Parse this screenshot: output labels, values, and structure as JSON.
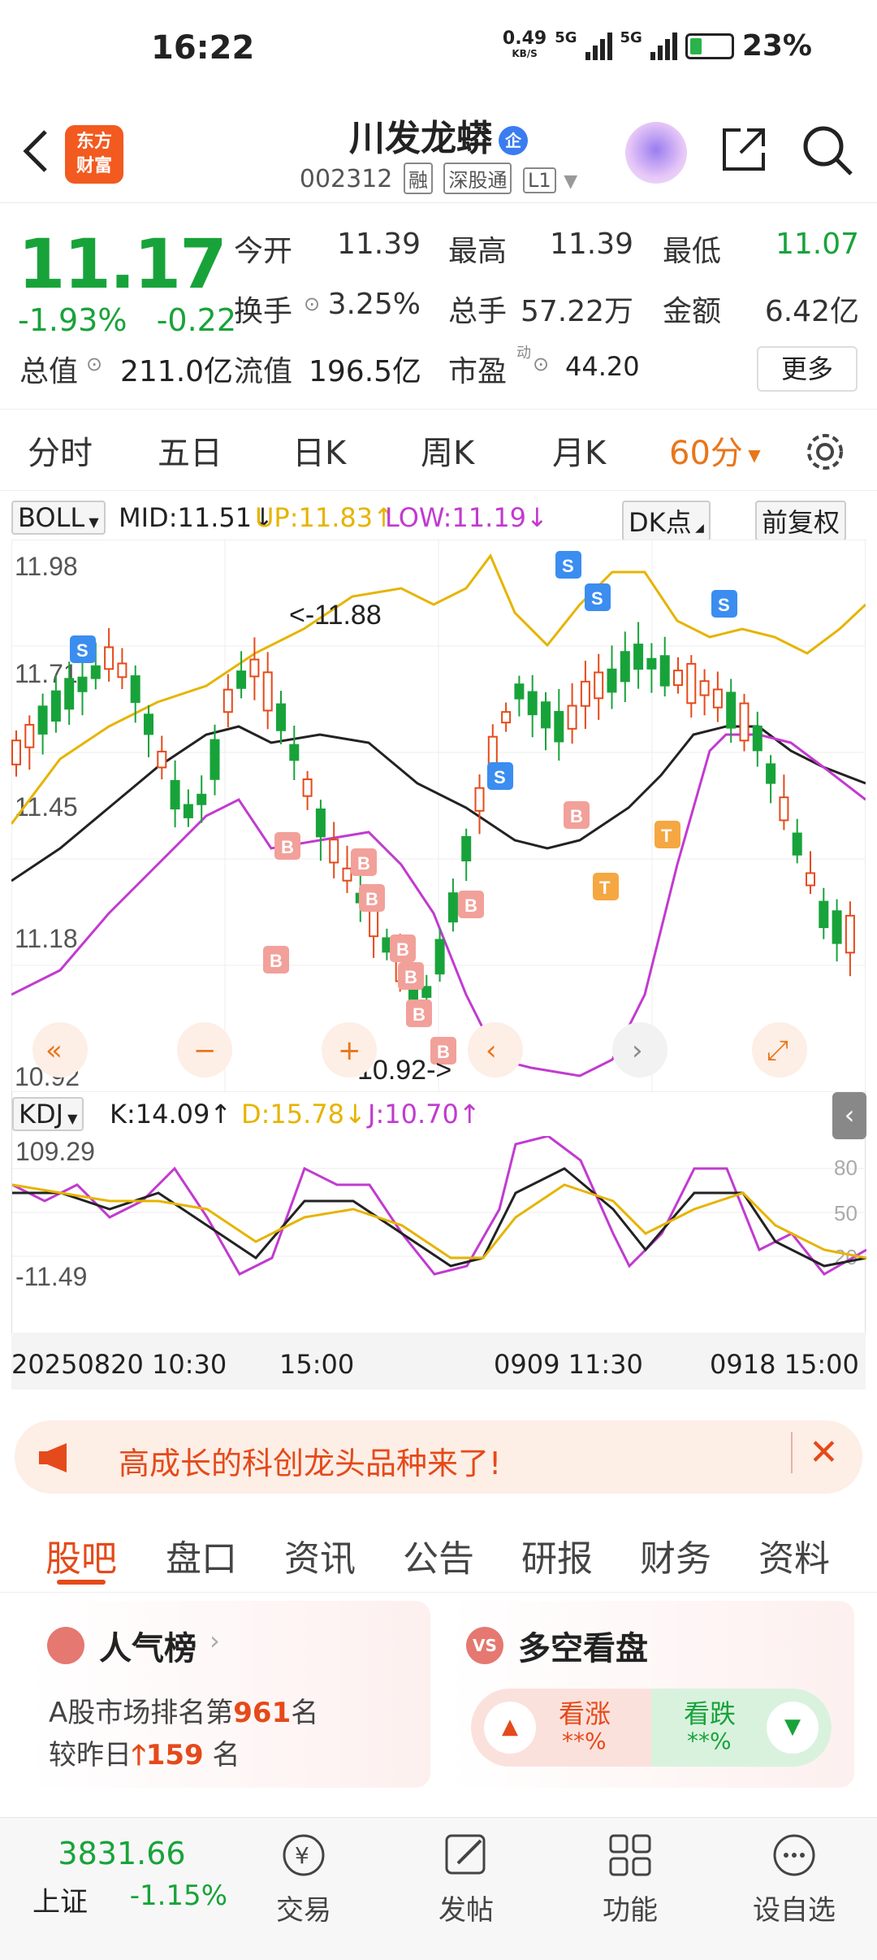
{
  "status_bar": {
    "time": "16:22",
    "net_speed": "0.49",
    "net_unit": "KB/S",
    "signal1": "5G",
    "signal2": "5G",
    "battery": "23%"
  },
  "header": {
    "logo_line1": "东方",
    "logo_line2": "财富",
    "stock_name": "川发龙蟒",
    "badge": "企",
    "stock_code": "002312",
    "tags": [
      "融",
      "深股通",
      "L1"
    ]
  },
  "quote": {
    "price": "11.17",
    "change_pct": "-1.93%",
    "change": "-0.22",
    "stats": [
      {
        "label": "今开",
        "value": "11.39",
        "color": "#333"
      },
      {
        "label": "最高",
        "value": "11.39",
        "color": "#333"
      },
      {
        "label": "最低",
        "value": "11.07",
        "color": "#18a33a"
      },
      {
        "label": "换手",
        "value": "3.25%",
        "color": "#333"
      },
      {
        "label": "总手",
        "value": "57.22万",
        "color": "#333"
      },
      {
        "label": "金额",
        "value": "6.42亿",
        "color": "#333"
      },
      {
        "label": "总值",
        "value": "211.0亿",
        "color": "#333"
      },
      {
        "label": "流值",
        "value": "196.5亿",
        "color": "#333"
      },
      {
        "label": "市盈",
        "value": "44.20",
        "color": "#333"
      }
    ],
    "pe_superscript": "动",
    "more_label": "更多"
  },
  "period_tabs": [
    "分时",
    "五日",
    "日K",
    "周K",
    "月K",
    "60分"
  ],
  "active_period": "60分",
  "boll": {
    "name": "BOLL",
    "mid": "MID:11.51↓",
    "up": "UP:11.83↑",
    "low": "LOW:11.19↓",
    "dk_label": "DK点",
    "adjust_label": "前复权"
  },
  "kdj": {
    "name": "KDJ",
    "k": "K:14.09↑",
    "d": "D:15.78↓",
    "j": "J:10.70↑",
    "y_top": "109.29",
    "y_bottom": "-11.49",
    "levels": [
      "80",
      "50",
      "20"
    ]
  },
  "chart_data": {
    "type": "candlestick",
    "y_ticks": [
      "11.98",
      "11.71",
      "11.45",
      "11.18",
      "10.92"
    ],
    "ylim": [
      10.92,
      11.98
    ],
    "max_annotation": "<-11.88",
    "min_annotation": "10.92->",
    "x_labels": [
      "20250820 10:30",
      "15:00",
      "0909 11:30",
      "0918 15:00"
    ],
    "signals": [
      "S",
      "B",
      "T"
    ]
  },
  "banner": {
    "text": "高成长的科创龙头品种来了!"
  },
  "content_tabs": [
    "股吧",
    "盘口",
    "资讯",
    "公告",
    "研报",
    "财务",
    "资料"
  ],
  "active_content_tab": "股吧",
  "popularity": {
    "title": "人气榜",
    "rank_prefix": "A股市场排名第",
    "rank": "961",
    "rank_suffix": "名",
    "change_prefix": "较昨日",
    "change": "159",
    "change_suffix": "名"
  },
  "sentiment": {
    "title": "多空看盘",
    "bull_label": "看涨",
    "bull_value": "**%",
    "bear_label": "看跌",
    "bear_value": "**%"
  },
  "bottom_nav": {
    "index_value": "3831.66",
    "index_name": "上证",
    "index_change": "-1.15%",
    "items": [
      "交易",
      "发帖",
      "功能",
      "设自选"
    ]
  },
  "colors": {
    "up": "#e54a1a",
    "down": "#18a33a",
    "accent": "#e8761b",
    "boll_up": "#e6b400",
    "boll_low": "#c23ad0"
  }
}
